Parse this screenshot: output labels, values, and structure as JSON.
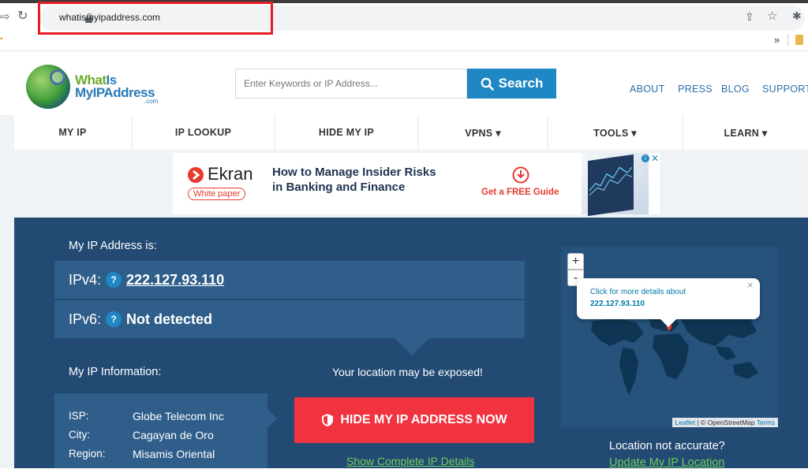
{
  "browser": {
    "url": "whatismyipaddress.com",
    "bookmarks_overflow": "»"
  },
  "header": {
    "logo_line1a": "What",
    "logo_line1b": "Is",
    "logo_line2": "MyIPAddress",
    "logo_line3": ".com",
    "search_placeholder": "Enter Keywords or IP Address...",
    "search_button": "Search",
    "links": [
      "ABOUT",
      "PRESS",
      "BLOG",
      "SUPPORT"
    ]
  },
  "nav": {
    "items": [
      "MY IP",
      "IP LOOKUP",
      "HIDE MY IP",
      "VPNS ▾",
      "TOOLS ▾",
      "LEARN ▾"
    ]
  },
  "ad": {
    "brand": "Ekran",
    "badge": "White paper",
    "headline_1": "How to Manage Insider Risks",
    "headline_2": "in Banking and Finance",
    "cta": "Get a FREE Guide"
  },
  "hero": {
    "my_ip_label": "My IP Address is:",
    "ipv4_label": "IPv4:",
    "ipv4_value": "222.127.93.110",
    "ipv6_label": "IPv6:",
    "ipv6_value": "Not detected",
    "info_label": "My IP Information:",
    "exposed_text": "Your location may be exposed!",
    "hide_button": "HIDE MY IP ADDRESS NOW",
    "show_details": "Show Complete IP Details",
    "info": [
      {
        "key": "ISP:",
        "value": "Globe Telecom Inc"
      },
      {
        "key": "City:",
        "value": "Cagayan de Oro"
      },
      {
        "key": "Region:",
        "value": "Misamis Oriental"
      }
    ],
    "not_accurate": "Location not accurate?",
    "update_location": "Update My IP Location"
  },
  "map": {
    "popup_line1": "Click for more details about",
    "popup_line2": "222.127.93.110",
    "zoom_in": "+",
    "zoom_out": "-",
    "close": "×",
    "attrib_leaflet": "Leaflet",
    "attrib_osm": " | © OpenStreetMap ",
    "attrib_terms": "Terms"
  },
  "colors": {
    "accent_blue": "#1f87c4",
    "hero_bg": "#224a73",
    "hide_red": "#f1323f",
    "highlight_red": "#e51c24"
  }
}
